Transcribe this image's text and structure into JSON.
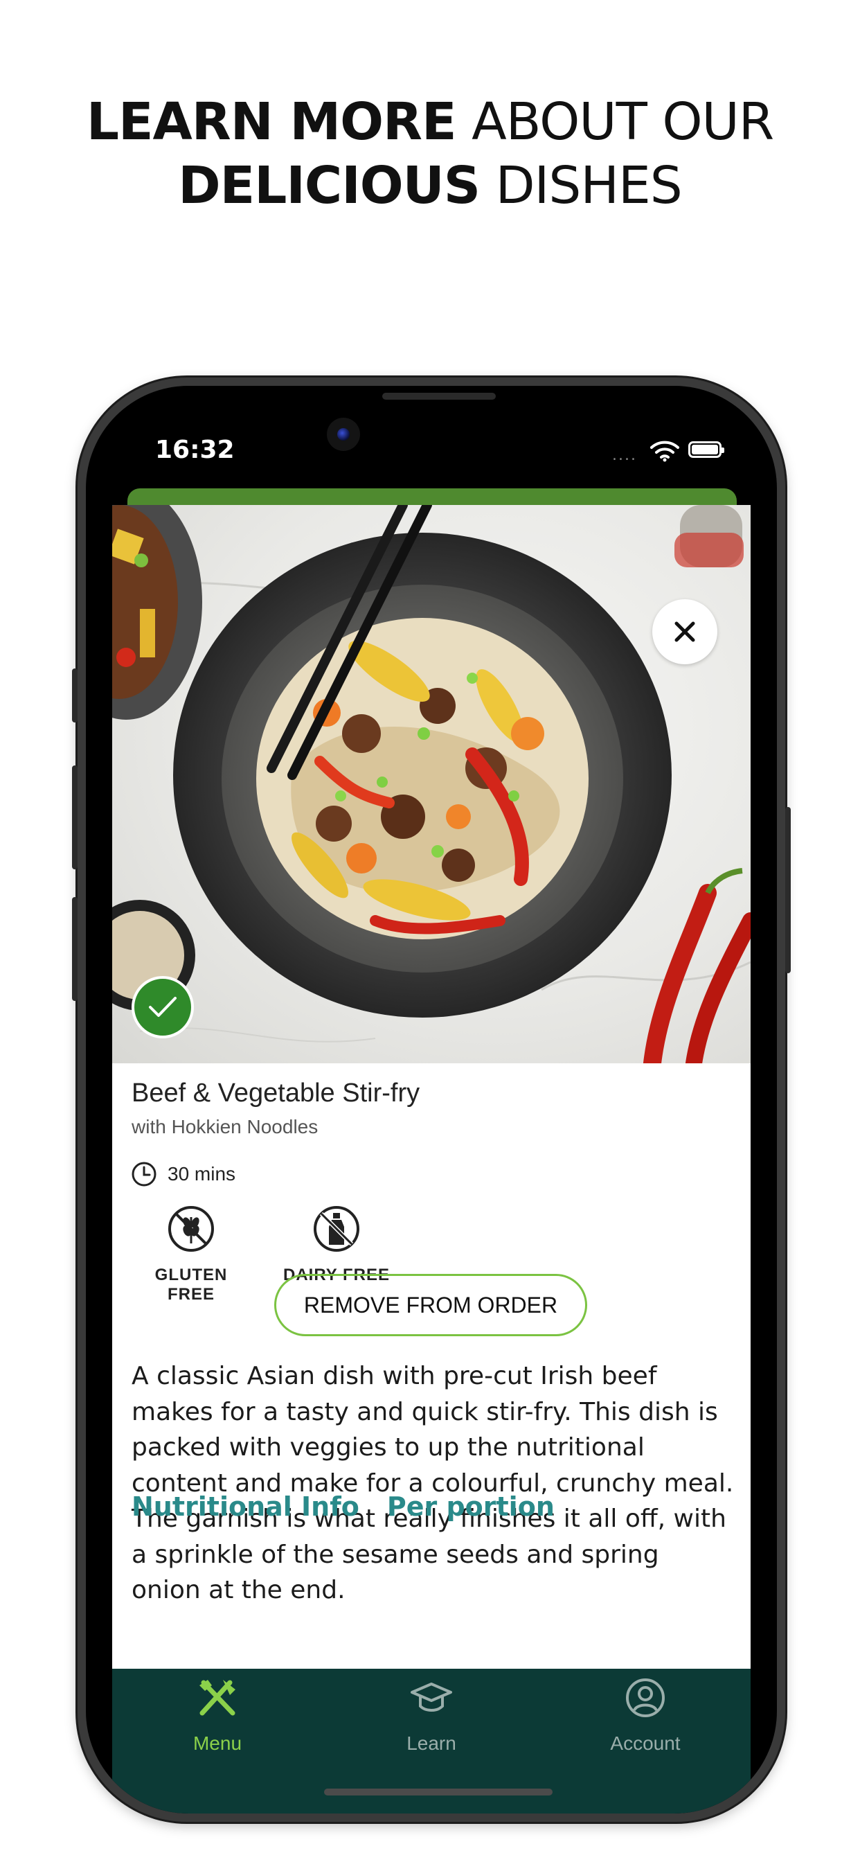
{
  "headline": {
    "line1_bold": "LEARN MORE",
    "line1_light": "ABOUT OUR",
    "line2_bold": "DELICIOUS",
    "line2_light": "DISHES"
  },
  "status_bar": {
    "time": "16:32",
    "signal": "....",
    "icons": [
      "wifi-icon",
      "battery-icon"
    ]
  },
  "dish": {
    "title": "Beef & Vegetable Stir-fry",
    "subtitle": "with Hokkien Noodles",
    "time": "30 mins",
    "selected": true,
    "dietary": [
      {
        "label": "GLUTEN FREE",
        "icon": "gluten-free-icon"
      },
      {
        "label": "DAIRY FREE",
        "icon": "dairy-free-icon"
      }
    ],
    "action_button": "REMOVE FROM ORDER",
    "description": "A classic Asian dish with pre-cut Irish beef makes for a tasty and quick stir-fry. This dish is packed with veggies to up the nutritional content and make for a colourful, crunchy meal. The garnish is what really finishes it all off, with a sprinkle of the sesame seeds and spring onion at the end.",
    "nutrition_heading": "Nutritional Info",
    "nutrition_subheading": "Per portion"
  },
  "tabbar": {
    "tabs": [
      {
        "label": "Menu",
        "icon": "cutlery-icon",
        "active": true
      },
      {
        "label": "Learn",
        "icon": "graduation-cap-icon",
        "active": false
      },
      {
        "label": "Account",
        "icon": "user-circle-icon",
        "active": false
      }
    ]
  },
  "colors": {
    "accent_green": "#7bc342",
    "tab_active": "#8bd14a",
    "tab_inactive": "#9aaeab",
    "tabbar_bg": "#0c3a36",
    "nutrition_teal": "#2a8a8a",
    "header_strip": "#4f8a2f"
  }
}
